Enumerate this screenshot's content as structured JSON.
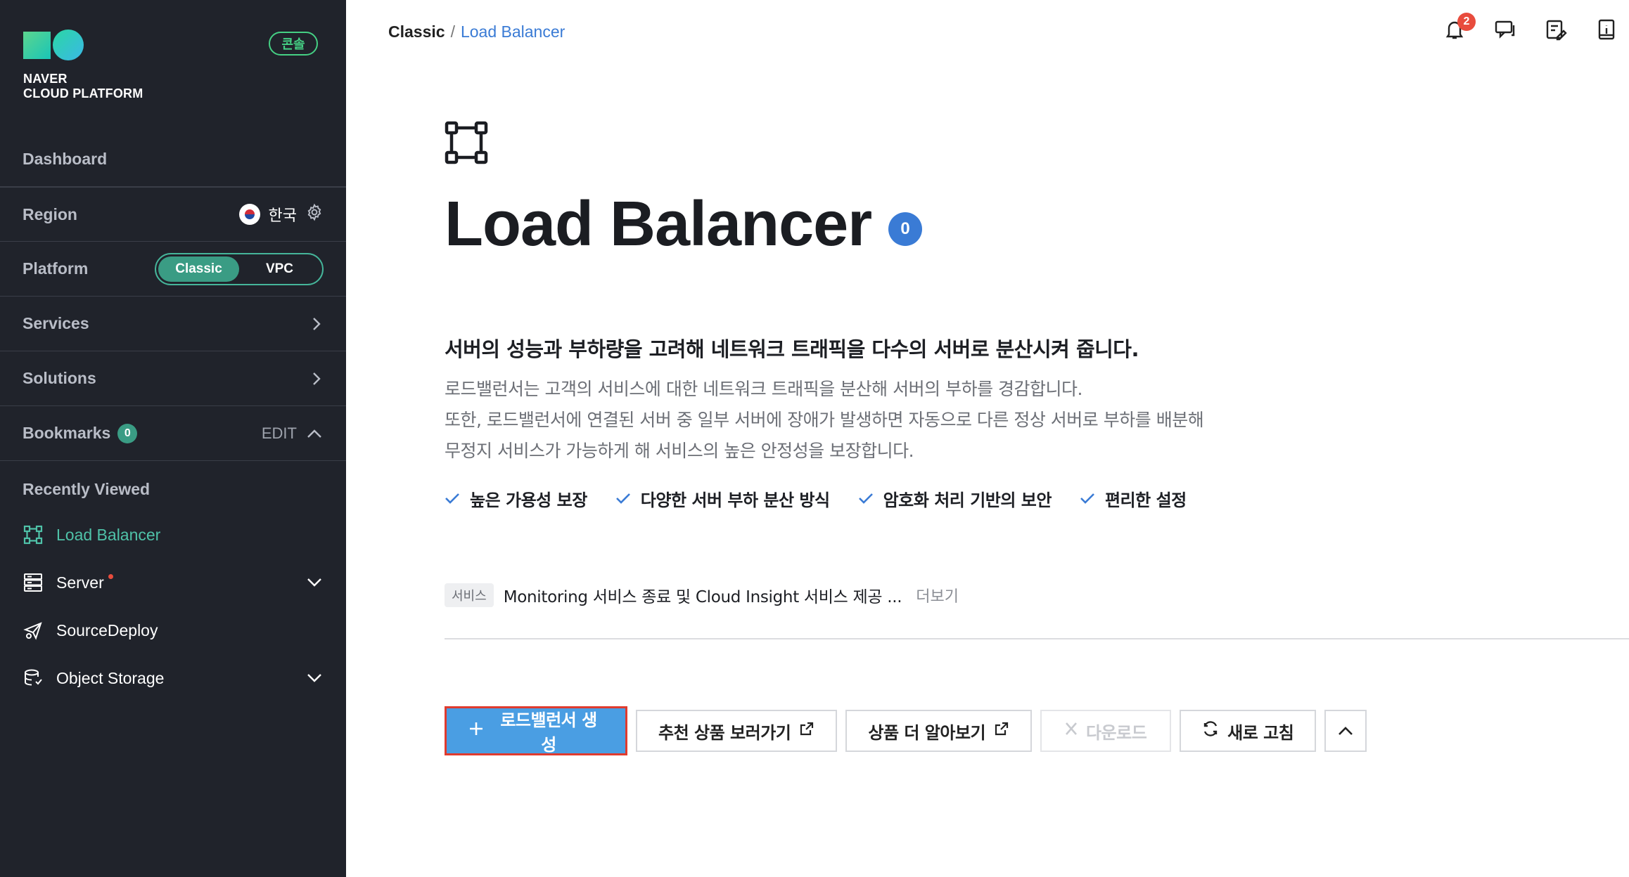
{
  "brand": {
    "line1": "NAVER",
    "line2": "CLOUD PLATFORM",
    "console_label": "콘솔"
  },
  "sidebar": {
    "dashboard": "Dashboard",
    "region": {
      "label": "Region",
      "value": "한국"
    },
    "platform": {
      "label": "Platform",
      "options": [
        "Classic",
        "VPC"
      ],
      "selected": "Classic"
    },
    "services": "Services",
    "solutions": "Solutions",
    "bookmarks": {
      "label": "Bookmarks",
      "count": "0",
      "edit": "EDIT"
    },
    "recently_viewed": {
      "title": "Recently Viewed",
      "items": [
        {
          "label": "Load Balancer",
          "icon": "load-balancer-icon"
        },
        {
          "label": "Server",
          "icon": "server-icon"
        },
        {
          "label": "SourceDeploy",
          "icon": "source-deploy-icon"
        },
        {
          "label": "Object Storage",
          "icon": "object-storage-icon"
        }
      ]
    }
  },
  "breadcrumb": {
    "root": "Classic",
    "sep": "/",
    "current": "Load Balancer"
  },
  "top_icons": {
    "notification_count": "2"
  },
  "main": {
    "title": "Load Balancer",
    "count": "0",
    "headline": "서버의 성능과 부하량을 고려해 네트워크 트래픽을 다수의 서버로 분산시켜 줍니다.",
    "desc_lines": [
      "로드밸런서는 고객의 서비스에 대한 네트워크 트래픽을 분산해 서버의 부하를 경감합니다.",
      "또한, 로드밸런서에 연결된 서버 중 일부 서버에 장애가 발생하면 자동으로 다른 정상 서버로 부하를 배분해",
      "무정지 서비스가 가능하게 해 서비스의 높은 안정성을 보장합니다."
    ],
    "features": [
      "높은 가용성 보장",
      "다양한 서버 부하 분산 방식",
      "암호화 처리 기반의 보안",
      "편리한 설정"
    ],
    "notice": {
      "tag": "서비스",
      "text": "Monitoring 서비스 종료 및 Cloud Insight 서비스 제공 ...",
      "more": "더보기"
    },
    "buttons": {
      "create": "로드밸런서 생성",
      "recommend": "추천 상품 보러가기",
      "learn_more": "상품 더 알아보기",
      "download": "다운로드",
      "refresh": "새로 고침"
    }
  },
  "colors": {
    "sidebar_bg": "#20232b",
    "accent_green": "#3a9c84",
    "primary_blue": "#4a9ee3",
    "link_blue": "#3a7bd5"
  }
}
